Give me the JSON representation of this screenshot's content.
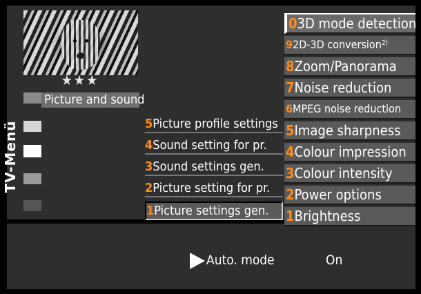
{
  "vertical_label": "TV-Menü",
  "stars": "★★★",
  "picture_and_sound": "Picture and sound",
  "left_menu": [
    {
      "num": "5",
      "label": "Picture profile settings"
    },
    {
      "num": "4",
      "label": "Sound setting for pr."
    },
    {
      "num": "3",
      "label": "Sound settings gen."
    },
    {
      "num": "2",
      "label": "Picture setting for pr."
    },
    {
      "num": "1",
      "label": "Picture settings gen."
    }
  ],
  "right_menu": [
    {
      "num": "0",
      "label": "3D mode detection"
    },
    {
      "num": "9",
      "label": "2D-3D conversion",
      "sup": "2)"
    },
    {
      "num": "8",
      "label": "Zoom/Panorama"
    },
    {
      "num": "7",
      "label": "Noise reduction"
    },
    {
      "num": "6",
      "label": "MPEG noise reduction"
    },
    {
      "num": "5",
      "label": "Image sharpness"
    },
    {
      "num": "4",
      "label": "Colour impression"
    },
    {
      "num": "3",
      "label": "Colour intensity"
    },
    {
      "num": "2",
      "label": "Power options"
    },
    {
      "num": "1",
      "label": "Brightness"
    }
  ],
  "bottom": {
    "setting": "Auto. mode",
    "value": "On"
  }
}
